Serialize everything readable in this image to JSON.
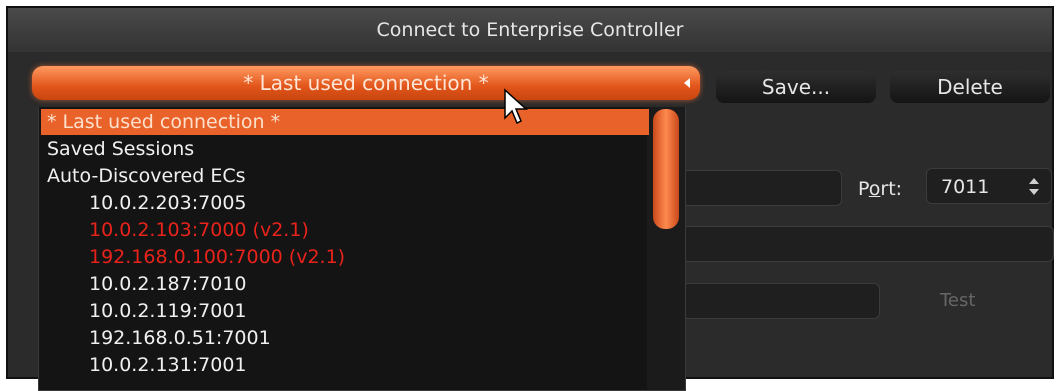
{
  "window": {
    "title": "Connect to Enterprise Controller"
  },
  "connection_combo": {
    "selected": "* Last used connection *"
  },
  "toolbar": {
    "save_label": "Save...",
    "delete_label": "Delete"
  },
  "port": {
    "label_prefix": "P",
    "label_accel": "o",
    "label_suffix": "rt:",
    "value": "7011"
  },
  "test_label": "Test",
  "dropdown": {
    "items": [
      {
        "label": "* Last used connection *",
        "kind": "selected"
      },
      {
        "label": "Saved Sessions",
        "kind": "header"
      },
      {
        "label": "Auto-Discovered ECs",
        "kind": "header"
      },
      {
        "label": "10.0.2.203:7005",
        "kind": "sub"
      },
      {
        "label": "10.0.2.103:7000 (v2.1)",
        "kind": "sub-red"
      },
      {
        "label": "192.168.0.100:7000 (v2.1)",
        "kind": "sub-red"
      },
      {
        "label": "10.0.2.187:7010",
        "kind": "sub"
      },
      {
        "label": "10.0.2.119:7001",
        "kind": "sub"
      },
      {
        "label": "192.168.0.51:7001",
        "kind": "sub"
      },
      {
        "label": "10.0.2.131:7001",
        "kind": "sub"
      }
    ]
  },
  "colors": {
    "accent": "#e8622a",
    "incompatible": "#e8231b",
    "background": "#2b2b2b"
  }
}
